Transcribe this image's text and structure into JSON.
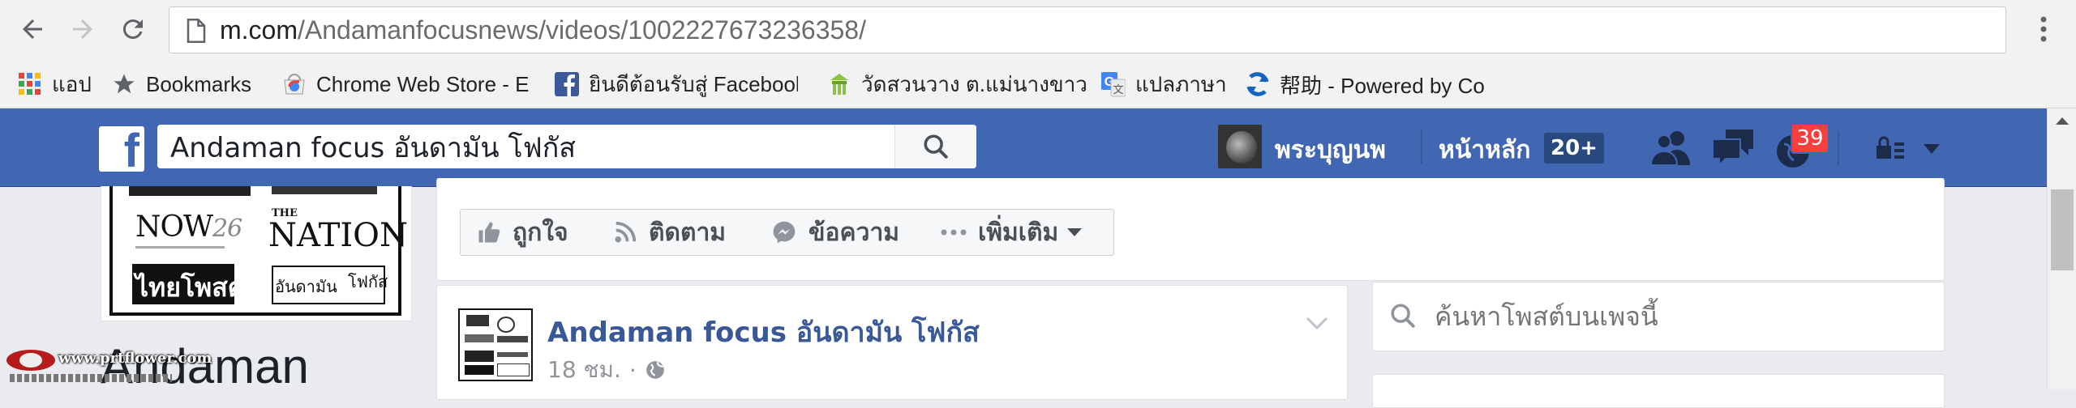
{
  "browser": {
    "url_host": "m.com",
    "url_path": "/Andamanfocusnews/videos/1002227673236358/",
    "bookmarks": [
      {
        "label": "แอป",
        "icon": "apps-grid-icon"
      },
      {
        "label": "Bookmarks",
        "icon": "star-icon"
      },
      {
        "label": "Chrome Web Store - E",
        "icon": "chrome-web-store-icon"
      },
      {
        "label": "ยินดีต้อนรับสู่ Facebook",
        "icon": "facebook-icon"
      },
      {
        "label": "วัดสวนวาง ต.แม่นางขาว อ",
        "icon": "site-favicon"
      },
      {
        "label": "แปลภาษา",
        "icon": "google-translate-icon"
      },
      {
        "label": "帮助 - Powered by Co",
        "icon": "help-site-icon"
      }
    ]
  },
  "fb": {
    "search_value": "Andaman focus อันดามัน โฟกัส",
    "user_name": "พระบุญนพ",
    "home_label": "หน้าหลัก",
    "home_count": "20+",
    "notifications_count": "39",
    "accent": "#4267b2"
  },
  "page": {
    "left_heading": "Andaman",
    "logo_now": "NOW",
    "logo_now_suffix": "26",
    "logo_nation": "NATION",
    "logo_the": "THE",
    "logo_thaipost": "ไทยโพสต์",
    "logo_andaman": "อันดามัน",
    "logo_focus": "โฟกัส",
    "actions": [
      {
        "label": "ถูกใจ",
        "icon": "thumbs-up-icon"
      },
      {
        "label": "ติดตาม",
        "icon": "rss-follow-icon"
      },
      {
        "label": "ข้อความ",
        "icon": "messenger-icon"
      },
      {
        "label": "เพิ่มเติม",
        "icon": "more-dots-icon"
      }
    ],
    "post": {
      "page_name": "Andaman focus อันดามัน โฟกัส",
      "time": "18 ชม.",
      "separator": "·"
    },
    "page_search_placeholder": "ค้นหาโพสต์บนเพจนี้",
    "watermark_site": "www.prtflower.com"
  }
}
